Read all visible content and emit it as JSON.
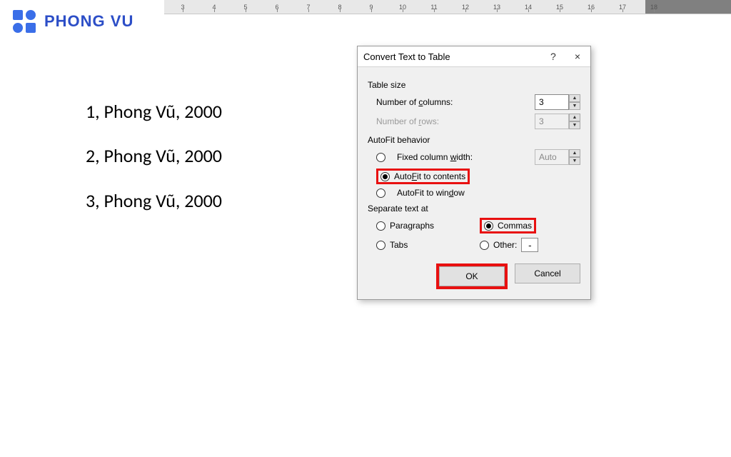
{
  "logo": {
    "text": "PHONG VU"
  },
  "ruler": {
    "units": [
      "3",
      "4",
      "5",
      "6",
      "7",
      "8",
      "9",
      "10",
      "11",
      "12",
      "13",
      "14",
      "15",
      "16",
      "17",
      "18"
    ]
  },
  "document": {
    "lines": [
      "1, Phong Vũ, 2000",
      "2, Phong Vũ, 2000",
      "3, Phong Vũ, 2000"
    ]
  },
  "dialog": {
    "title": "Convert Text to Table",
    "help": "?",
    "close": "×",
    "table_size_label": "Table size",
    "cols_label": "Number of columns:",
    "cols_value": "3",
    "rows_label": "Number of rows:",
    "rows_value": "3",
    "autofit_label": "AutoFit behavior",
    "fixed_width_label": "Fixed column width:",
    "fixed_width_value": "Auto",
    "autofit_contents_label": "AutoFit to contents",
    "autofit_window_label": "AutoFit to window",
    "separate_label": "Separate text at",
    "paragraphs_label": "Paragraphs",
    "commas_label": "Commas",
    "tabs_label": "Tabs",
    "other_label": "Other:",
    "other_value": "-",
    "ok_label": "OK",
    "cancel_label": "Cancel"
  }
}
